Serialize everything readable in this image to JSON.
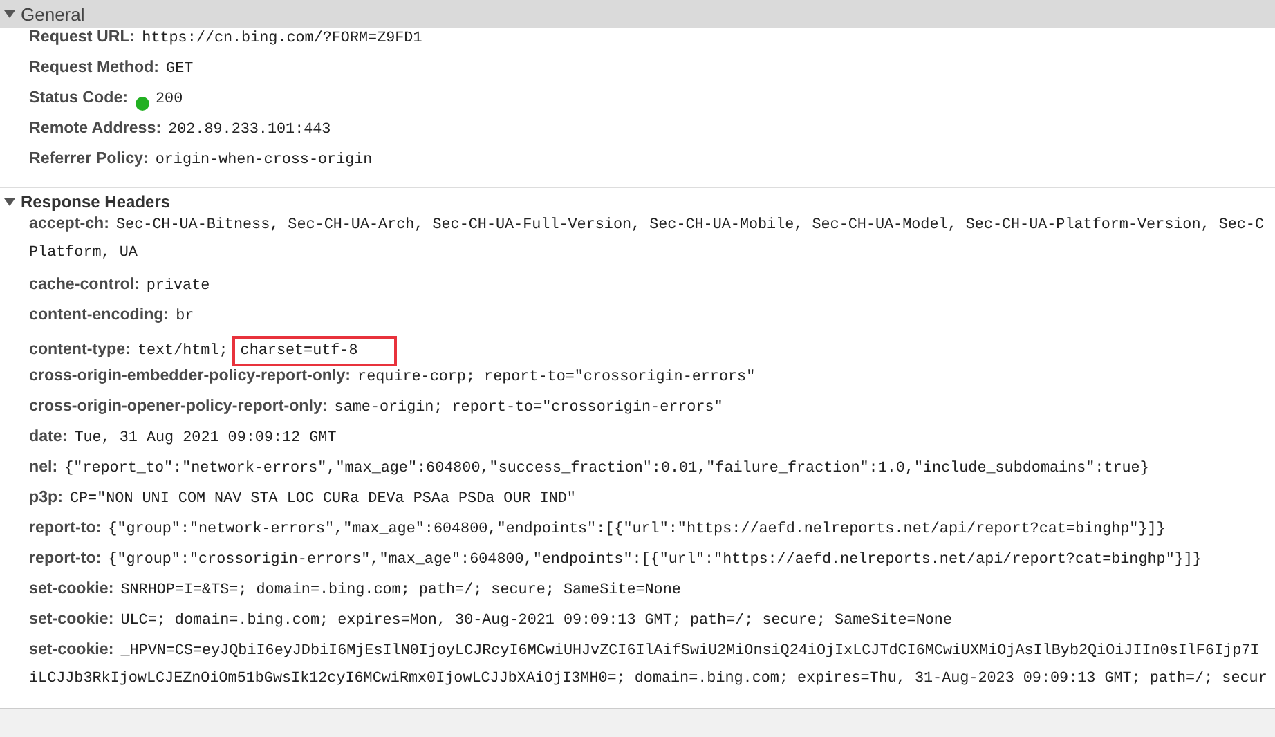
{
  "sections": [
    {
      "title": "General",
      "expanded": true,
      "highlighted": true,
      "rows": [
        {
          "name": "Request URL:",
          "lines": [
            "https://cn.bing.com/?FORM=Z9FD1"
          ]
        },
        {
          "name": "Request Method:",
          "lines": [
            "GET"
          ]
        },
        {
          "name": "Status Code:",
          "color": "#22b022",
          "lines": [
            "200"
          ]
        },
        {
          "name": "Remote Address:",
          "lines": [
            "202.89.233.101:443"
          ]
        },
        {
          "name": "Referrer Policy:",
          "lines": [
            "origin-when-cross-origin"
          ]
        }
      ]
    },
    {
      "title": "Response Headers",
      "expanded": true,
      "highlighted": false,
      "rows": [
        {
          "name": "accept-ch:",
          "lines": [
            "Sec-CH-UA-Bitness, Sec-CH-UA-Arch, Sec-CH-UA-Full-Version, Sec-CH-UA-Mobile, Sec-CH-UA-Model, Sec-CH-UA-Platform-Version, Sec-C",
            "Platform, UA"
          ]
        },
        {
          "name": "cache-control:",
          "lines": [
            "private"
          ]
        },
        {
          "name": "content-encoding:",
          "lines": [
            "br"
          ]
        },
        {
          "name": "content-type:",
          "lines": [
            "text/html;"
          ],
          "highlight": "charset=utf-8"
        },
        {
          "name": "cross-origin-embedder-policy-report-only:",
          "lines": [
            "require-corp; report-to=\"crossorigin-errors\""
          ]
        },
        {
          "name": "cross-origin-opener-policy-report-only:",
          "lines": [
            "same-origin; report-to=\"crossorigin-errors\""
          ]
        },
        {
          "name": "date:",
          "lines": [
            "Tue, 31 Aug 2021 09:09:12 GMT"
          ]
        },
        {
          "name": "nel:",
          "lines": [
            "{\"report_to\":\"network-errors\",\"max_age\":604800,\"success_fraction\":0.01,\"failure_fraction\":1.0,\"include_subdomains\":true}"
          ]
        },
        {
          "name": "p3p:",
          "lines": [
            "CP=\"NON UNI COM NAV STA LOC CURa DEVa PSAa PSDa OUR IND\""
          ]
        },
        {
          "name": "report-to:",
          "lines": [
            "{\"group\":\"network-errors\",\"max_age\":604800,\"endpoints\":[{\"url\":\"https://aefd.nelreports.net/api/report?cat=binghp\"}]}"
          ]
        },
        {
          "name": "report-to:",
          "lines": [
            "{\"group\":\"crossorigin-errors\",\"max_age\":604800,\"endpoints\":[{\"url\":\"https://aefd.nelreports.net/api/report?cat=binghp\"}]}"
          ]
        },
        {
          "name": "set-cookie:",
          "lines": [
            "SNRHOP=I=&TS=; domain=.bing.com; path=/; secure; SameSite=None"
          ]
        },
        {
          "name": "set-cookie:",
          "lines": [
            "ULC=; domain=.bing.com; expires=Mon, 30-Aug-2021 09:09:13 GMT; path=/; secure; SameSite=None"
          ]
        },
        {
          "name": "set-cookie:",
          "lines": [
            "_HPVN=CS=eyJQbiI6eyJDbiI6MjEsIlN0IjoyLCJRcyI6MCwiUHJvZCI6IlAifSwiU2MiOnsiQ24iOjIxLCJTdCI6MCwiUXMiOjAsIlByb2QiOiJIIn0sIlF6Ijp7I",
            "iLCJJb3RkIjowLCJEZnOiOm51bGwsIk12cyI6MCwiRmx0IjowLCJJbXAiOjI3MH0=; domain=.bing.com; expires=Thu, 31-Aug-2023 09:09:13 GMT; path=/; secur"
          ]
        }
      ]
    }
  ]
}
